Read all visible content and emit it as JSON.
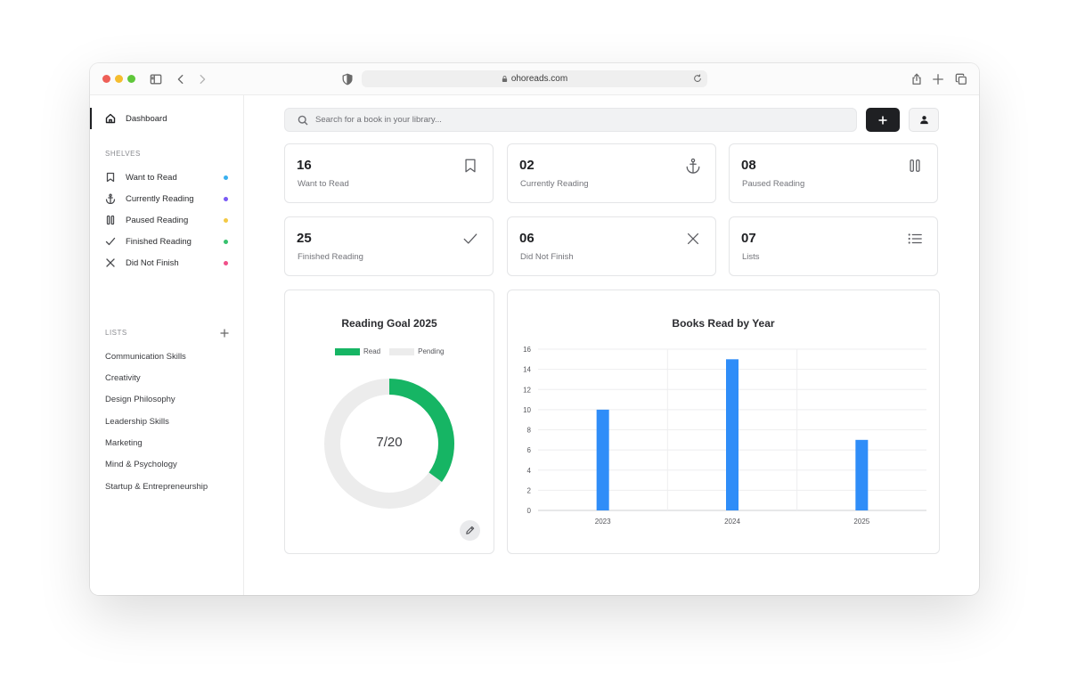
{
  "browser": {
    "url": "ohoreads.com",
    "traffic_lights": [
      "#ee5f57",
      "#f5bd2f",
      "#5fc73a"
    ]
  },
  "sidebar": {
    "dashboard_label": "Dashboard",
    "shelves_heading": "SHELVES",
    "shelves": [
      {
        "label": "Want to Read",
        "icon": "bookmark-icon",
        "dot": "#3ab0ef"
      },
      {
        "label": "Currently Reading",
        "icon": "anchor-icon",
        "dot": "#7a5af5"
      },
      {
        "label": "Paused Reading",
        "icon": "pause-icon",
        "dot": "#f3c945"
      },
      {
        "label": "Finished Reading",
        "icon": "check-icon",
        "dot": "#37c26e"
      },
      {
        "label": "Did Not Finish",
        "icon": "x-icon",
        "dot": "#f0508a"
      }
    ],
    "lists_heading": "LISTS",
    "lists": [
      "Communication Skills",
      "Creativity",
      "Design Philosophy",
      "Leadership Skills",
      "Marketing",
      "Mind & Psychology",
      "Startup & Entrepreneurship"
    ]
  },
  "search": {
    "placeholder": "Search for a book in your library..."
  },
  "stats": [
    {
      "value": "16",
      "label": "Want to Read",
      "icon": "bookmark-icon"
    },
    {
      "value": "02",
      "label": "Currently Reading",
      "icon": "anchor-icon"
    },
    {
      "value": "08",
      "label": "Paused Reading",
      "icon": "pause-icon"
    },
    {
      "value": "25",
      "label": "Finished Reading",
      "icon": "check-icon"
    },
    {
      "value": "06",
      "label": "Did Not Finish",
      "icon": "x-icon"
    },
    {
      "value": "07",
      "label": "Lists",
      "icon": "list-icon"
    }
  ],
  "goal": {
    "title": "Reading Goal 2025",
    "legend_read": "Read",
    "legend_pending": "Pending",
    "read": 7,
    "total": 20,
    "display": "7/20",
    "read_color": "#16b564",
    "pending_color": "#ececec"
  },
  "chart_data": {
    "type": "bar",
    "title": "Books Read by Year",
    "categories": [
      "2023",
      "2024",
      "2025"
    ],
    "values": [
      10,
      15,
      7
    ],
    "ylim": [
      0,
      16
    ],
    "yticks": [
      "0",
      "2",
      "4",
      "6",
      "8",
      "10",
      "12",
      "14",
      "16"
    ],
    "bar_color": "#2f8df8",
    "grid": true
  }
}
